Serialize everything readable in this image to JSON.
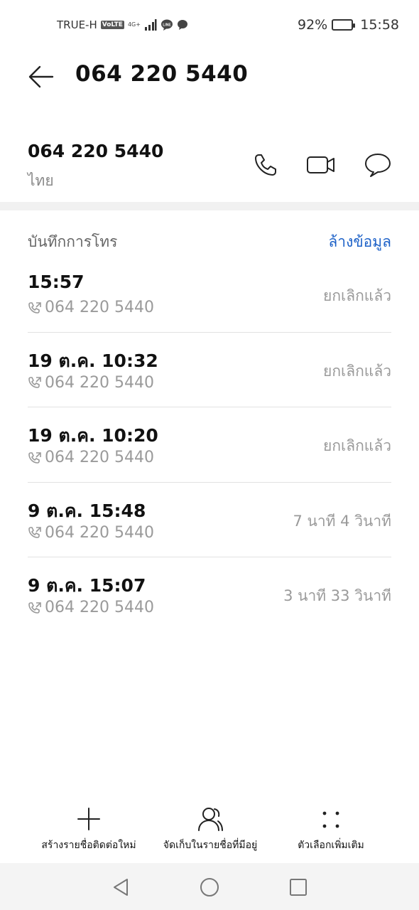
{
  "status_bar": {
    "carrier": "TRUE-H",
    "volte": "VoLTE",
    "network": "4G+",
    "battery_text": "92%",
    "battery_level": 0.92,
    "time": "15:58"
  },
  "header": {
    "title": "064 220 5440",
    "back_icon": "arrow-left-icon"
  },
  "contact": {
    "number": "064 220 5440",
    "region": "ไทย",
    "actions": [
      "phone-icon",
      "video-call-icon",
      "message-icon"
    ]
  },
  "call_log": {
    "title": "บันทึกการโทร",
    "clear_label": "ล้างข้อมูล",
    "entries": [
      {
        "time": "15:57",
        "number": "064 220 5440",
        "status": "ยกเลิกแล้ว"
      },
      {
        "time": "19 ต.ค. 10:32",
        "number": "064 220 5440",
        "status": "ยกเลิกแล้ว"
      },
      {
        "time": "19 ต.ค. 10:20",
        "number": "064 220 5440",
        "status": "ยกเลิกแล้ว"
      },
      {
        "time": "9 ต.ค. 15:48",
        "number": "064 220 5440",
        "status": "7 นาที 4 วินาที"
      },
      {
        "time": "9 ต.ค. 15:07",
        "number": "064 220 5440",
        "status": "3 นาที 33 วินาที"
      }
    ]
  },
  "bottom_actions": {
    "new_contact": "สร้างรายชื่อติดต่อใหม่",
    "save_existing": "จัดเก็บในรายชื่อที่มีอยู่",
    "more_options": "ตัวเลือกเพิ่มเติม"
  },
  "nav": {
    "back": "triangle-back-icon",
    "home": "circle-home-icon",
    "recents": "square-recents-icon"
  },
  "colors": {
    "accent": "#1e62c8",
    "secondary_text": "#9a9a9a",
    "divider": "#e2e2e2"
  }
}
